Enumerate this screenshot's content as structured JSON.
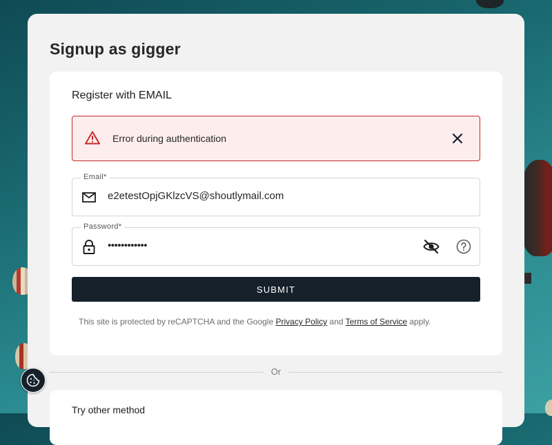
{
  "page": {
    "title": "Signup as gigger"
  },
  "register": {
    "heading": "Register with EMAIL"
  },
  "alert": {
    "message": "Error during authentication",
    "color": "#c62828"
  },
  "email": {
    "label": "Email*",
    "value": "e2etestOpjGKlzcVS@shoutlymail.com"
  },
  "password": {
    "label": "Password*",
    "masked_value": "••••••••••••"
  },
  "submit": {
    "label": "SUBMIT",
    "color": "#15202b"
  },
  "recaptcha": {
    "prefix": "This site is protected by reCAPTCHA and the Google",
    "privacy_link": "Privacy Policy",
    "and": "and",
    "terms_link": "Terms of Service",
    "suffix": "apply."
  },
  "divider": {
    "label": "Or"
  },
  "other_method": {
    "heading": "Try other method"
  },
  "icons": {
    "alert": "warning-triangle-icon",
    "close": "close-icon",
    "email": "mail-icon",
    "password": "lock-icon",
    "visibility": "eye-slash-icon",
    "help": "help-circle-icon",
    "cookie": "cookie-icon"
  }
}
